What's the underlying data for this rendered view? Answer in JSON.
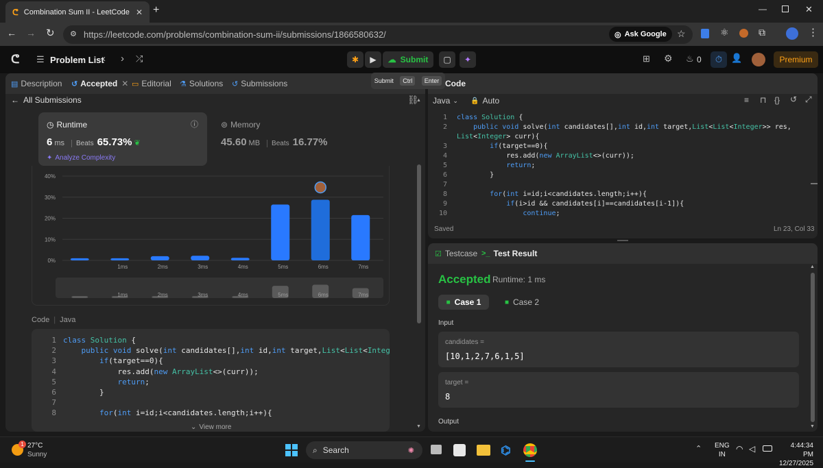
{
  "browser": {
    "tab_title": "Combination Sum II - LeetCode",
    "url": "https://leetcode.com/problems/combination-sum-ii/submissions/1866580632/",
    "ask_google": "Ask Google"
  },
  "lc_header": {
    "problem_list": "Problem List",
    "submit": "Submit",
    "premium": "Premium",
    "streak_count": "0",
    "tooltip": {
      "submit": "Submit",
      "ctrl": "Ctrl",
      "enter": "Enter"
    }
  },
  "left_panel": {
    "tabs": [
      "Description",
      "Accepted",
      "Editorial",
      "Solutions",
      "Submissions"
    ],
    "all_submissions": "All Submissions",
    "runtime": {
      "label": "Runtime",
      "value": "6",
      "unit": "ms",
      "beats_label": "Beats",
      "beats": "65.73%",
      "analyze": "Analyze Complexity"
    },
    "memory": {
      "label": "Memory",
      "value": "45.60",
      "unit": "MB",
      "beats_label": "Beats",
      "beats": "16.77%"
    },
    "code_header": {
      "label": "Code",
      "lang": "Java"
    },
    "view_more": "View more",
    "code_lines": [
      {
        "n": "1",
        "t": "class Solution {"
      },
      {
        "n": "2",
        "t": "    public void solve(int candidates[],int id,int target,List<List<Integer>>"
      },
      {
        "n": "3",
        "t": "        if(target==0){"
      },
      {
        "n": "4",
        "t": "            res.add(new ArrayList<>(curr));"
      },
      {
        "n": "5",
        "t": "            return;"
      },
      {
        "n": "6",
        "t": "        }"
      },
      {
        "n": "7",
        "t": ""
      },
      {
        "n": "8",
        "t": "        for(int i=id;i<candidates.length;i++){"
      }
    ]
  },
  "chart_data": {
    "type": "bar",
    "categories": [
      "",
      "1ms",
      "2ms",
      "3ms",
      "4ms",
      "5ms",
      "6ms",
      "7ms"
    ],
    "values": [
      1.0,
      1.0,
      2.0,
      2.2,
      1.2,
      26.5,
      28.8,
      21.5
    ],
    "highlight_index": 6,
    "yticks": [
      "0%",
      "10%",
      "20%",
      "30%",
      "40%"
    ],
    "ylim": [
      0,
      40
    ],
    "colors": {
      "bar": "#2979ff",
      "highlight": "#1f6ddb",
      "grid": "#3a3a3a"
    },
    "mini_labels": [
      "1ms",
      "2ms",
      "3ms",
      "4ms",
      "5ms",
      "6ms",
      "7ms"
    ]
  },
  "right_panel": {
    "code_title": "Code",
    "lang": "Java",
    "auto": "Auto",
    "saved": "Saved",
    "cursor": "Ln 23, Col 33",
    "lines": [
      {
        "n": "1",
        "t": "class Solution {"
      },
      {
        "n": "2",
        "t": "    public void solve(int candidates[],int id,int target,List<List<Integer>> res,"
      },
      {
        "n": "",
        "t": "List<Integer> curr){"
      },
      {
        "n": "3",
        "t": "        if(target==0){"
      },
      {
        "n": "4",
        "t": "            res.add(new ArrayList<>(curr));"
      },
      {
        "n": "5",
        "t": "            return;"
      },
      {
        "n": "6",
        "t": "        }"
      },
      {
        "n": "7",
        "t": ""
      },
      {
        "n": "8",
        "t": "        for(int i=id;i<candidates.length;i++){"
      },
      {
        "n": "9",
        "t": "            if(i>id && candidates[i]==candidates[i-1]){"
      },
      {
        "n": "10",
        "t": "                continue;"
      }
    ],
    "testcase_tab": "Testcase",
    "result_tab": "Test Result",
    "status": "Accepted",
    "runtime": "Runtime: 1 ms",
    "cases": [
      "Case 1",
      "Case 2"
    ],
    "input_label": "Input",
    "inputs": [
      {
        "name": "candidates =",
        "value": "[10,1,2,7,6,1,5]"
      },
      {
        "name": "target =",
        "value": "8"
      }
    ],
    "output_label": "Output"
  },
  "taskbar": {
    "temp": "27°C",
    "weather": "Sunny",
    "badge": "1",
    "search": "Search",
    "lang1": "ENG",
    "lang2": "IN",
    "time": "4:44:34 PM",
    "date": "12/27/2025"
  }
}
